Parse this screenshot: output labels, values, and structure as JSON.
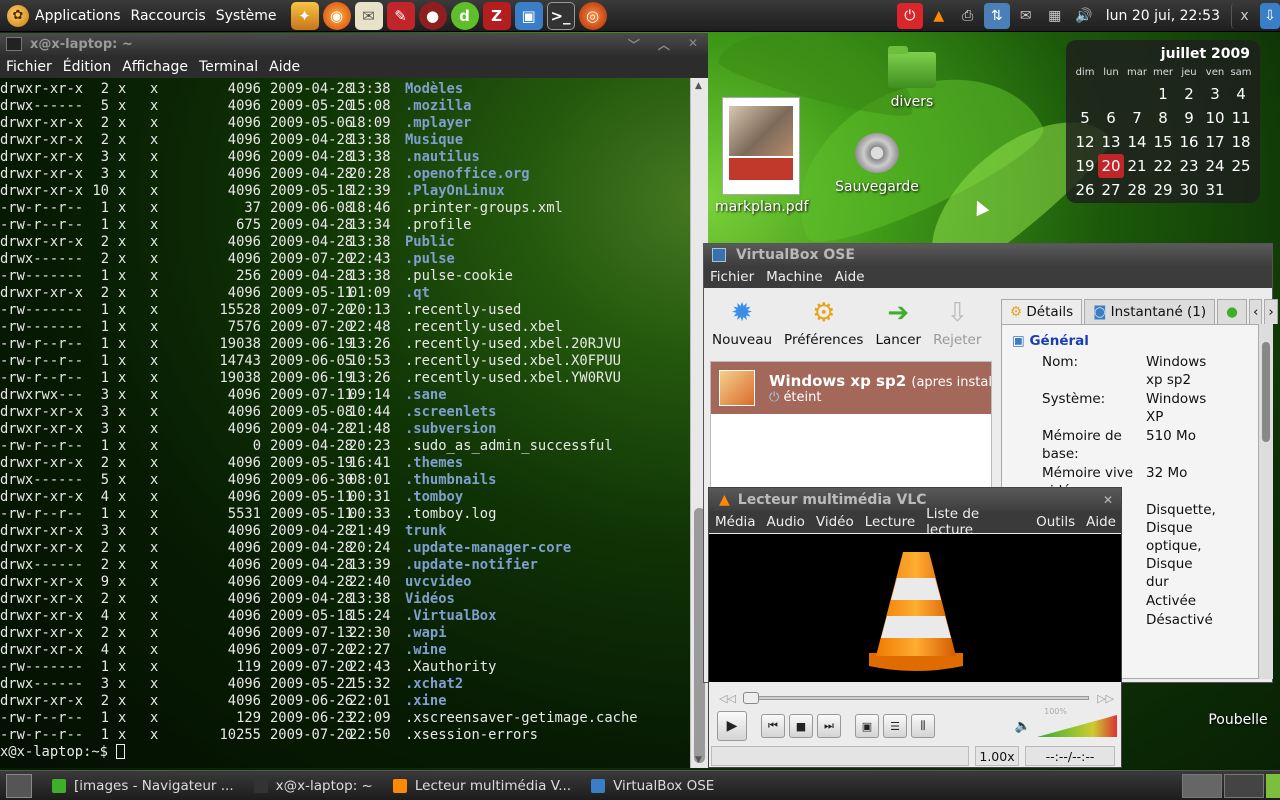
{
  "top_panel": {
    "menu": [
      "Applications",
      "Raccourcis",
      "Système"
    ],
    "launchers": [
      "firefox-icon",
      "thunderbird-icon",
      "mail-icon",
      "red-tool-icon",
      "game-icon",
      "dreamweaver-icon",
      "filezilla-icon",
      "virtualbox-icon",
      "terminal-icon",
      "burner-icon"
    ],
    "clock": "lun 20 jui, 22:53"
  },
  "terminal": {
    "title": "x@x-laptop: ~",
    "menu": [
      "Fichier",
      "Édition",
      "Affichage",
      "Terminal",
      "Aide"
    ],
    "rows": [
      [
        "drwxr-xr-x",
        "2",
        "x",
        "x",
        "4096",
        "2009-04-28",
        "13:38",
        "Modèles",
        true
      ],
      [
        "drwx------",
        "5",
        "x",
        "x",
        "4096",
        "2009-05-20",
        "15:08",
        ".mozilla",
        true
      ],
      [
        "drwxr-xr-x",
        "2",
        "x",
        "x",
        "4096",
        "2009-05-06",
        "18:09",
        ".mplayer",
        true
      ],
      [
        "drwxr-xr-x",
        "2",
        "x",
        "x",
        "4096",
        "2009-04-28",
        "13:38",
        "Musique",
        true
      ],
      [
        "drwxr-xr-x",
        "3",
        "x",
        "x",
        "4096",
        "2009-04-28",
        "13:38",
        ".nautilus",
        true
      ],
      [
        "drwxr-xr-x",
        "3",
        "x",
        "x",
        "4096",
        "2009-04-28",
        "20:28",
        ".openoffice.org",
        true
      ],
      [
        "drwxr-xr-x",
        "10",
        "x",
        "x",
        "4096",
        "2009-05-18",
        "12:39",
        ".PlayOnLinux",
        true
      ],
      [
        "-rw-r--r--",
        "1",
        "x",
        "x",
        "37",
        "2009-06-08",
        "18:46",
        ".printer-groups.xml",
        false
      ],
      [
        "-rw-r--r--",
        "1",
        "x",
        "x",
        "675",
        "2009-04-28",
        "13:34",
        ".profile",
        false
      ],
      [
        "drwxr-xr-x",
        "2",
        "x",
        "x",
        "4096",
        "2009-04-28",
        "13:38",
        "Public",
        true
      ],
      [
        "drwx------",
        "2",
        "x",
        "x",
        "4096",
        "2009-07-20",
        "22:43",
        ".pulse",
        true
      ],
      [
        "-rw-------",
        "1",
        "x",
        "x",
        "256",
        "2009-04-28",
        "13:38",
        ".pulse-cookie",
        false
      ],
      [
        "drwxr-xr-x",
        "2",
        "x",
        "x",
        "4096",
        "2009-05-11",
        "01:09",
        ".qt",
        true
      ],
      [
        "-rw-------",
        "1",
        "x",
        "x",
        "15528",
        "2009-07-20",
        "20:13",
        ".recently-used",
        false
      ],
      [
        "-rw-------",
        "1",
        "x",
        "x",
        "7576",
        "2009-07-20",
        "22:48",
        ".recently-used.xbel",
        false
      ],
      [
        "-rw-r--r--",
        "1",
        "x",
        "x",
        "19038",
        "2009-06-19",
        "13:26",
        ".recently-used.xbel.20RJVU",
        false
      ],
      [
        "-rw-r--r--",
        "1",
        "x",
        "x",
        "14743",
        "2009-06-05",
        "10:53",
        ".recently-used.xbel.X0FPUU",
        false
      ],
      [
        "-rw-r--r--",
        "1",
        "x",
        "x",
        "19038",
        "2009-06-19",
        "13:26",
        ".recently-used.xbel.YW0RVU",
        false
      ],
      [
        "drwxrwx---",
        "3",
        "x",
        "x",
        "4096",
        "2009-07-11",
        "09:14",
        ".sane",
        true
      ],
      [
        "drwxr-xr-x",
        "3",
        "x",
        "x",
        "4096",
        "2009-05-08",
        "10:44",
        ".screenlets",
        true
      ],
      [
        "drwxr-xr-x",
        "3",
        "x",
        "x",
        "4096",
        "2009-04-28",
        "21:48",
        ".subversion",
        true
      ],
      [
        "-rw-r--r--",
        "1",
        "x",
        "x",
        "0",
        "2009-04-28",
        "20:23",
        ".sudo_as_admin_successful",
        false
      ],
      [
        "drwxr-xr-x",
        "2",
        "x",
        "x",
        "4096",
        "2009-05-19",
        "16:41",
        ".themes",
        true
      ],
      [
        "drwx------",
        "5",
        "x",
        "x",
        "4096",
        "2009-06-30",
        "08:01",
        ".thumbnails",
        true
      ],
      [
        "drwxr-xr-x",
        "4",
        "x",
        "x",
        "4096",
        "2009-05-11",
        "00:31",
        ".tomboy",
        true
      ],
      [
        "-rw-r--r--",
        "1",
        "x",
        "x",
        "5531",
        "2009-05-11",
        "00:33",
        ".tomboy.log",
        false
      ],
      [
        "drwxr-xr-x",
        "3",
        "x",
        "x",
        "4096",
        "2009-04-28",
        "21:49",
        "trunk",
        true
      ],
      [
        "drwxr-xr-x",
        "2",
        "x",
        "x",
        "4096",
        "2009-04-28",
        "20:24",
        ".update-manager-core",
        true
      ],
      [
        "drwx------",
        "2",
        "x",
        "x",
        "4096",
        "2009-04-28",
        "13:39",
        ".update-notifier",
        true
      ],
      [
        "drwxr-xr-x",
        "9",
        "x",
        "x",
        "4096",
        "2009-04-28",
        "22:40",
        "uvcvideo",
        true
      ],
      [
        "drwxr-xr-x",
        "2",
        "x",
        "x",
        "4096",
        "2009-04-28",
        "13:38",
        "Vidéos",
        true
      ],
      [
        "drwxr-xr-x",
        "4",
        "x",
        "x",
        "4096",
        "2009-05-18",
        "15:24",
        ".VirtualBox",
        true
      ],
      [
        "drwxr-xr-x",
        "2",
        "x",
        "x",
        "4096",
        "2009-07-13",
        "22:30",
        ".wapi",
        true
      ],
      [
        "drwxr-xr-x",
        "4",
        "x",
        "x",
        "4096",
        "2009-07-20",
        "22:27",
        ".wine",
        true
      ],
      [
        "-rw-------",
        "1",
        "x",
        "x",
        "119",
        "2009-07-20",
        "22:43",
        ".Xauthority",
        false
      ],
      [
        "drwx------",
        "3",
        "x",
        "x",
        "4096",
        "2009-05-22",
        "15:32",
        ".xchat2",
        true
      ],
      [
        "drwxr-xr-x",
        "2",
        "x",
        "x",
        "4096",
        "2009-06-26",
        "22:01",
        ".xine",
        true
      ],
      [
        "-rw-r--r--",
        "1",
        "x",
        "x",
        "129",
        "2009-06-23",
        "22:09",
        ".xscreensaver-getimage.cache",
        false
      ],
      [
        "-rw-r--r--",
        "1",
        "x",
        "x",
        "10255",
        "2009-07-20",
        "22:50",
        ".xsession-errors",
        false
      ]
    ],
    "prompt": "x@x-laptop:~$ "
  },
  "desktop": {
    "icons": {
      "divers": "divers",
      "markplan": "markplan.pdf",
      "sauvegarde": "Sauvegarde",
      "poubelle": "Poubelle"
    },
    "calendar": {
      "title": "juillet 2009",
      "dow": [
        "dim",
        "lun",
        "mar",
        "mer",
        "jeu",
        "ven",
        "sam"
      ],
      "weeks": [
        [
          "",
          "",
          "",
          "1",
          "2",
          "3",
          "4"
        ],
        [
          "5",
          "6",
          "7",
          "8",
          "9",
          "10",
          "11"
        ],
        [
          "12",
          "13",
          "14",
          "15",
          "16",
          "17",
          "18"
        ],
        [
          "19",
          "20",
          "21",
          "22",
          "23",
          "24",
          "25"
        ],
        [
          "26",
          "27",
          "28",
          "29",
          "30",
          "31",
          ""
        ]
      ],
      "today": "20"
    }
  },
  "virtualbox": {
    "title": "VirtualBox OSE",
    "menu": [
      "Fichier",
      "Machine",
      "Aide"
    ],
    "toolbar": {
      "new": "Nouveau",
      "prefs": "Préférences",
      "start": "Lancer",
      "discard": "Rejeter"
    },
    "vm": {
      "name": "Windows xp sp2",
      "name_suffix": "(apres install",
      "state": "éteint"
    },
    "tabs": {
      "details": "Détails",
      "snapshot": "Instantané (1)"
    },
    "details": {
      "section": "Général",
      "rows": [
        {
          "label": "Nom:",
          "value": "Windows xp sp2"
        },
        {
          "label": "Système:",
          "value": "Windows XP"
        },
        {
          "label": "Mémoire de base:",
          "value": "510 Mo"
        },
        {
          "label": "Mémoire vive vidéo:",
          "value": "32 Mo"
        },
        {
          "label": "",
          "value": "Disquette, Disque optique, Disque dur"
        },
        {
          "label": "",
          "value": "Activée"
        },
        {
          "label": "",
          "value": "Désactivé"
        }
      ]
    }
  },
  "vlc": {
    "title": "Lecteur multimédia VLC",
    "menu": [
      "Média",
      "Audio",
      "Vidéo",
      "Lecture",
      "Liste de lecture",
      "Outils",
      "Aide"
    ],
    "speed": "1.00x",
    "time": "--:--/--:--",
    "volume": "100%"
  },
  "taskbar": {
    "tasks": [
      "[images - Navigateur ...",
      "x@x-laptop: ~",
      "Lecteur multimédia V...",
      "VirtualBox OSE"
    ]
  },
  "colors": {
    "vm_selected": "#a4685b",
    "today_highlight": "#c0252a",
    "dir_text": "#7f9fcf",
    "section_blue": "#1a3fb2"
  }
}
